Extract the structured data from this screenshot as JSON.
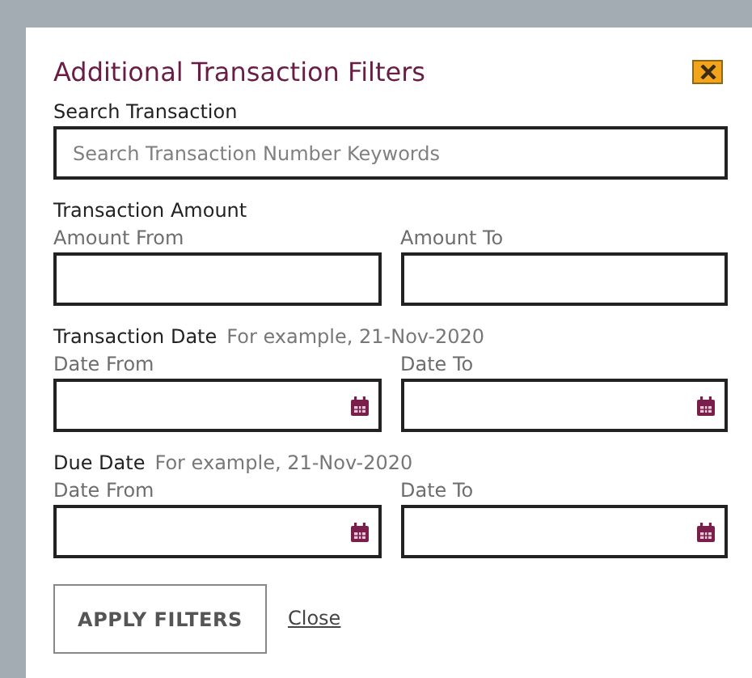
{
  "dialog": {
    "title": "Additional Transaction Filters"
  },
  "sections": [
    {
      "kind": "search",
      "label": "Search Transaction",
      "fields": [
        {
          "placeholder": "Search Transaction Number Keywords"
        }
      ]
    },
    {
      "kind": "amount",
      "label": "Transaction Amount",
      "fields": [
        {
          "label": "Amount From"
        },
        {
          "label": "Amount To"
        }
      ]
    },
    {
      "kind": "date",
      "label": "Transaction Date",
      "hint": "For example, 21-Nov-2020",
      "fields": [
        {
          "label": "Date From"
        },
        {
          "label": "Date To"
        }
      ]
    },
    {
      "kind": "date",
      "label": "Due Date",
      "hint": "For example, 21-Nov-2020",
      "fields": [
        {
          "label": "Date From"
        },
        {
          "label": "Date To"
        }
      ]
    }
  ],
  "actions": {
    "apply": "APPLY FILTERS",
    "close": "Close"
  }
}
